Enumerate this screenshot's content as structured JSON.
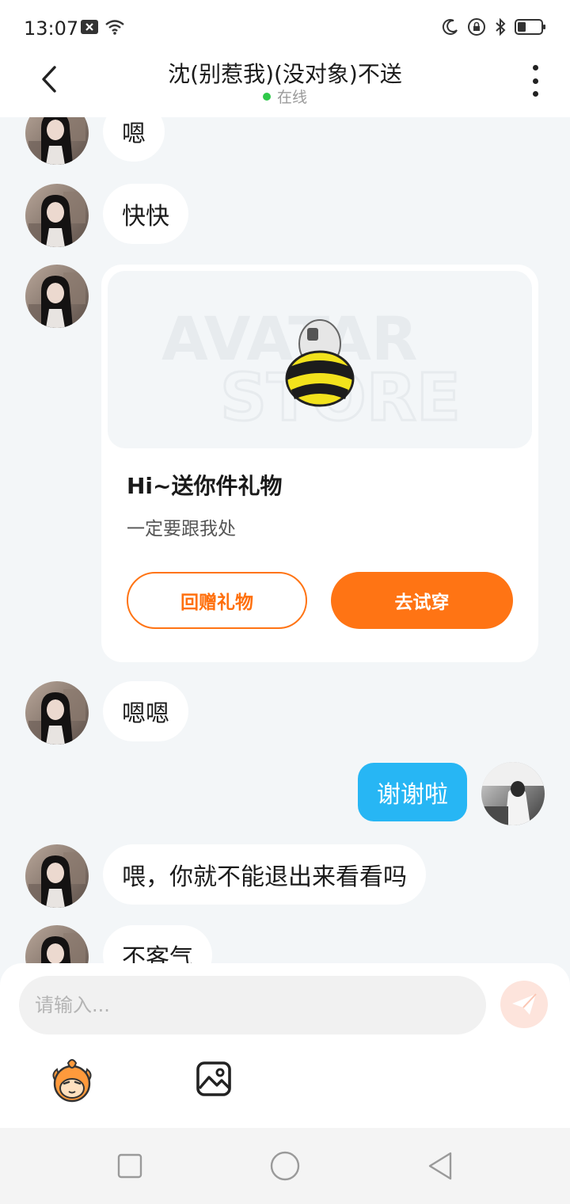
{
  "status_bar": {
    "time": "13:07",
    "left_icons": [
      "notification-x-icon",
      "wifi-icon"
    ],
    "right_icons": [
      "moon-icon",
      "rotation-lock-icon",
      "bluetooth-icon",
      "battery-icon"
    ]
  },
  "header": {
    "title": "沈(别惹我)(没对象)不送",
    "status": "在线",
    "status_color": "#2fc94a"
  },
  "messages": [
    {
      "side": "left",
      "text": "嗯"
    },
    {
      "side": "left",
      "text": "快快"
    },
    {
      "side": "left",
      "type": "gift_card",
      "image_watermark": [
        "AVATAR",
        "STORE"
      ],
      "title": "Hi~送你件礼物",
      "subtitle": "一定要跟我处",
      "button_return": "回赠礼物",
      "button_try": "去试穿"
    },
    {
      "side": "left",
      "text": "嗯嗯"
    },
    {
      "side": "right",
      "text": "谢谢啦"
    },
    {
      "side": "left",
      "text": "喂，你就不能退出来看看吗"
    },
    {
      "side": "left",
      "text": "不客气"
    }
  ],
  "input": {
    "placeholder": "请输入..."
  },
  "toolbar": {
    "icons": [
      "emoji-mascot-icon",
      "image-picker-icon"
    ]
  },
  "nav_bar": {
    "icons": [
      "recent-apps-icon",
      "home-icon",
      "back-icon"
    ]
  },
  "colors": {
    "accent_orange": "#ff7414",
    "my_bubble": "#27b6f4",
    "chat_bg": "#f3f6f8"
  }
}
